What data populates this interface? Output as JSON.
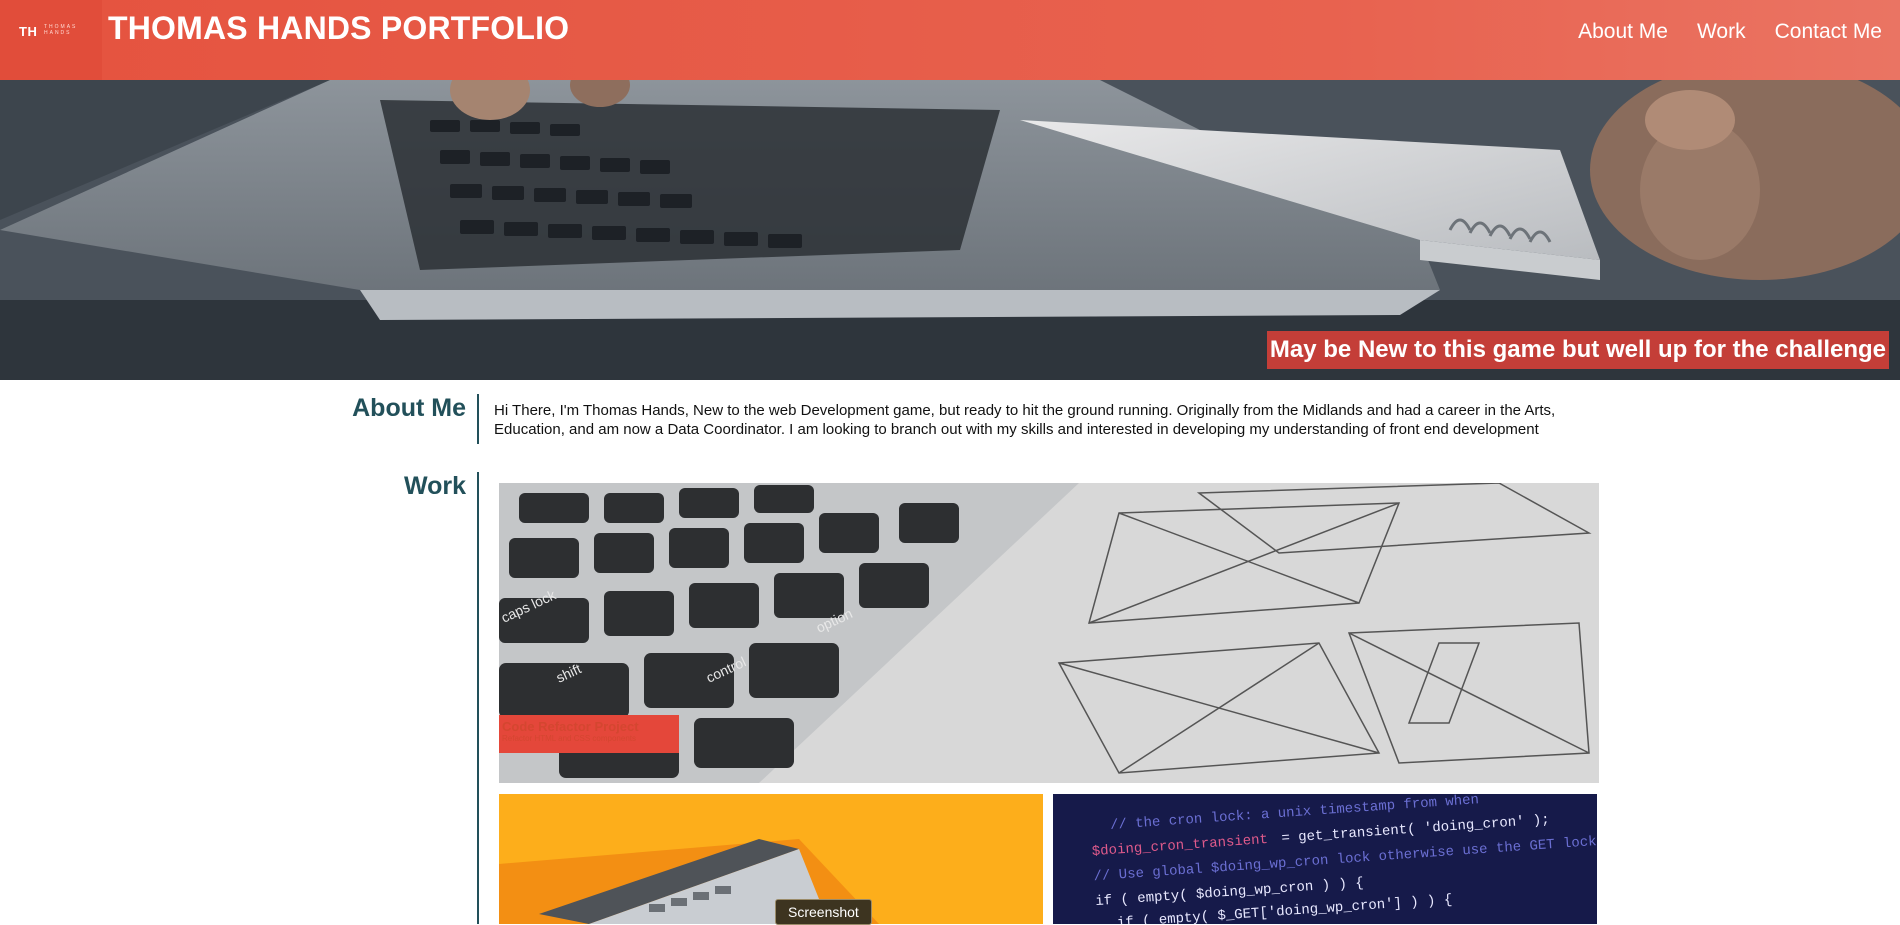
{
  "header": {
    "logo_th": "TH",
    "logo_small": "THOMAS HANDS",
    "title": "THOMAS HANDS PORTFOLIO",
    "nav": [
      {
        "label": "About Me"
      },
      {
        "label": "Work"
      },
      {
        "label": "Contact Me"
      }
    ]
  },
  "hero": {
    "tagline": "May be New to this game but well up for the challenge"
  },
  "about": {
    "heading": "About Me",
    "text": "Hi There, I'm Thomas Hands, New to the web Development game, but ready to hit the ground running. Originally from the Midlands and had a career in the Arts, Education, and am now a Data Coordinator. I am looking to branch out with my skills and interested in developing my understanding of front end development"
  },
  "work": {
    "heading": "Work",
    "featured": {
      "title": "Code Refactor Project",
      "subtitle": "Refactor HTML and CSS components"
    },
    "tooltip": "Screenshot"
  },
  "colors": {
    "header_accent": "#e5533f",
    "section_heading": "#22505a",
    "tagline_bg": "#c43e38",
    "yellow_tile": "#fdae1b",
    "code_tile": "#141848"
  }
}
